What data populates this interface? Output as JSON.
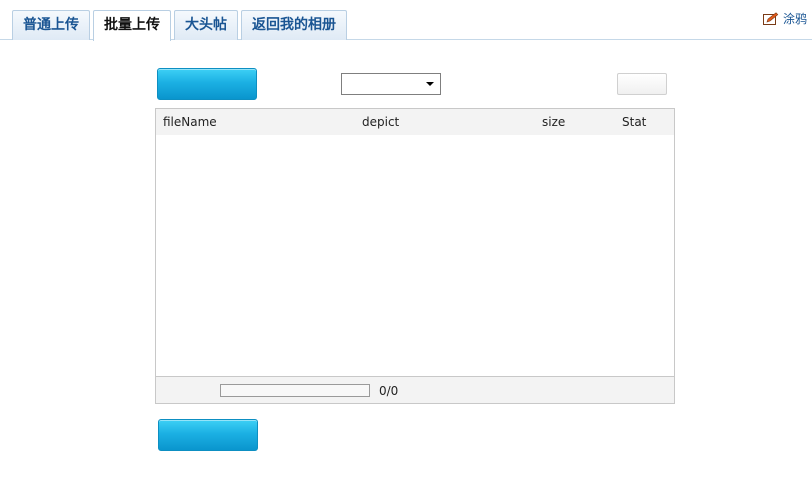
{
  "tabs": [
    {
      "label": "普通上传",
      "active": false
    },
    {
      "label": "批量上传",
      "active": true
    },
    {
      "label": "大头帖",
      "active": false
    },
    {
      "label": "返回我的相册",
      "active": false
    }
  ],
  "graffiti": {
    "icon": "edit-icon",
    "label": "涂鸦"
  },
  "toolbar": {
    "add_button_label": "",
    "select_value": "",
    "gray_button_label": ""
  },
  "file_table": {
    "columns": [
      "fileName",
      "depict",
      "size",
      "Stat"
    ],
    "rows": [],
    "progress": {
      "fraction": 0,
      "text": "0/0"
    }
  },
  "start_button_label": "",
  "colors": {
    "accent_blue": "#1bb0e3",
    "tab_text": "#1a5593"
  }
}
